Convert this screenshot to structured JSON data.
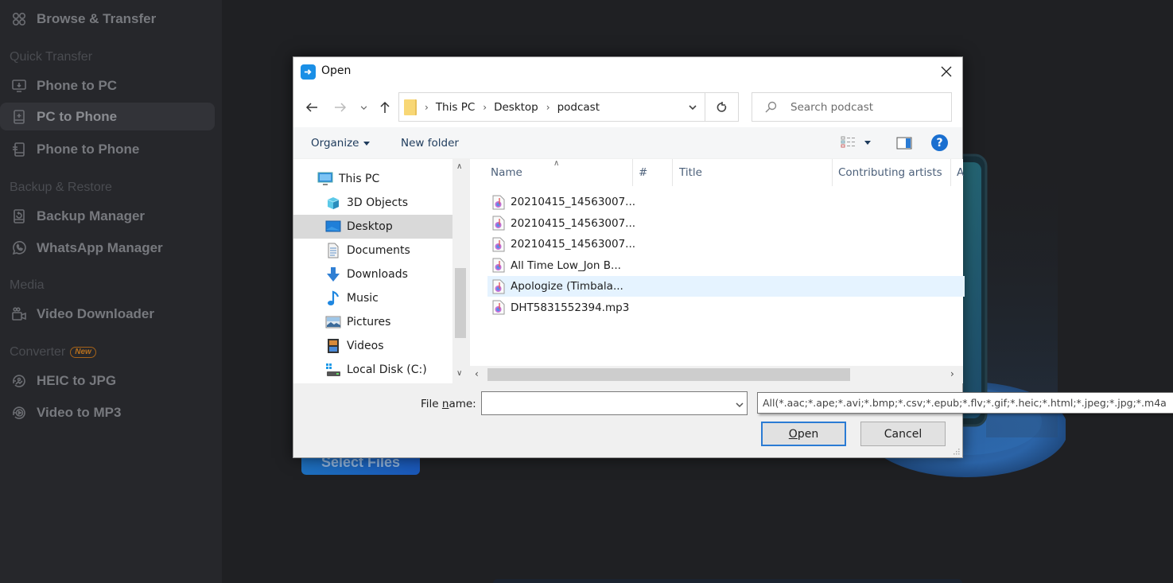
{
  "sidebar": {
    "top_item": {
      "label": "Browse & Transfer",
      "icon": "grid-icon"
    },
    "sections": [
      {
        "title": "Quick Transfer",
        "items": [
          {
            "label": "Phone to PC",
            "icon": "phone-to-pc-icon"
          },
          {
            "label": "PC to Phone",
            "icon": "pc-to-phone-icon",
            "active": true
          },
          {
            "label": "Phone to Phone",
            "icon": "phone-to-phone-icon"
          }
        ]
      },
      {
        "title": "Backup & Restore",
        "items": [
          {
            "label": "Backup Manager",
            "icon": "backup-icon"
          },
          {
            "label": "WhatsApp Manager",
            "icon": "whatsapp-icon"
          }
        ]
      },
      {
        "title": "Media",
        "items": [
          {
            "label": "Video Downloader",
            "icon": "video-camera-icon"
          }
        ]
      },
      {
        "title": "Converter",
        "badge": "New",
        "items": [
          {
            "label": "HEIC to JPG",
            "icon": "image-convert-icon"
          },
          {
            "label": "Video to MP3",
            "icon": "video-convert-icon"
          }
        ]
      }
    ]
  },
  "main": {
    "select_files_label": "Select Files"
  },
  "dialog": {
    "title": "Open",
    "breadcrumb": [
      "This PC",
      "Desktop",
      "podcast"
    ],
    "search_placeholder": "Search podcast",
    "toolbar": {
      "organize_label": "Organize",
      "new_folder_label": "New folder"
    },
    "nav_tree": [
      {
        "label": "This PC",
        "icon": "computer-icon",
        "level": 0
      },
      {
        "label": "3D Objects",
        "icon": "3d-objects-icon",
        "level": 1
      },
      {
        "label": "Desktop",
        "icon": "desktop-icon",
        "level": 1,
        "selected": true
      },
      {
        "label": "Documents",
        "icon": "documents-icon",
        "level": 1
      },
      {
        "label": "Downloads",
        "icon": "downloads-icon",
        "level": 1
      },
      {
        "label": "Music",
        "icon": "music-icon",
        "level": 1
      },
      {
        "label": "Pictures",
        "icon": "pictures-icon",
        "level": 1
      },
      {
        "label": "Videos",
        "icon": "videos-icon",
        "level": 1
      },
      {
        "label": "Local Disk (C:)",
        "icon": "drive-icon",
        "level": 1
      }
    ],
    "columns": [
      "Name",
      "#",
      "Title",
      "Contributing artists",
      "A"
    ],
    "files": [
      {
        "name": "20210415_14563007..."
      },
      {
        "name": "20210415_14563007..."
      },
      {
        "name": "20210415_14563007..."
      },
      {
        "name": "All Time Low_Jon B..."
      },
      {
        "name": "Apologize (Timbala...",
        "hover": true
      },
      {
        "name": "DHT5831552394.mp3"
      }
    ],
    "file_name_label_pre": "File ",
    "file_name_label_u": "n",
    "file_name_label_post": "ame:",
    "file_name_value": "",
    "file_type_filter": "All(*.aac;*.ape;*.avi;*.bmp;*.csv;*.epub;*.flv;*.gif;*.heic;*.html;*.jpeg;*.jpg;*.m4a",
    "open_label_u": "O",
    "open_label_rest": "pen",
    "cancel_label": "Cancel"
  }
}
